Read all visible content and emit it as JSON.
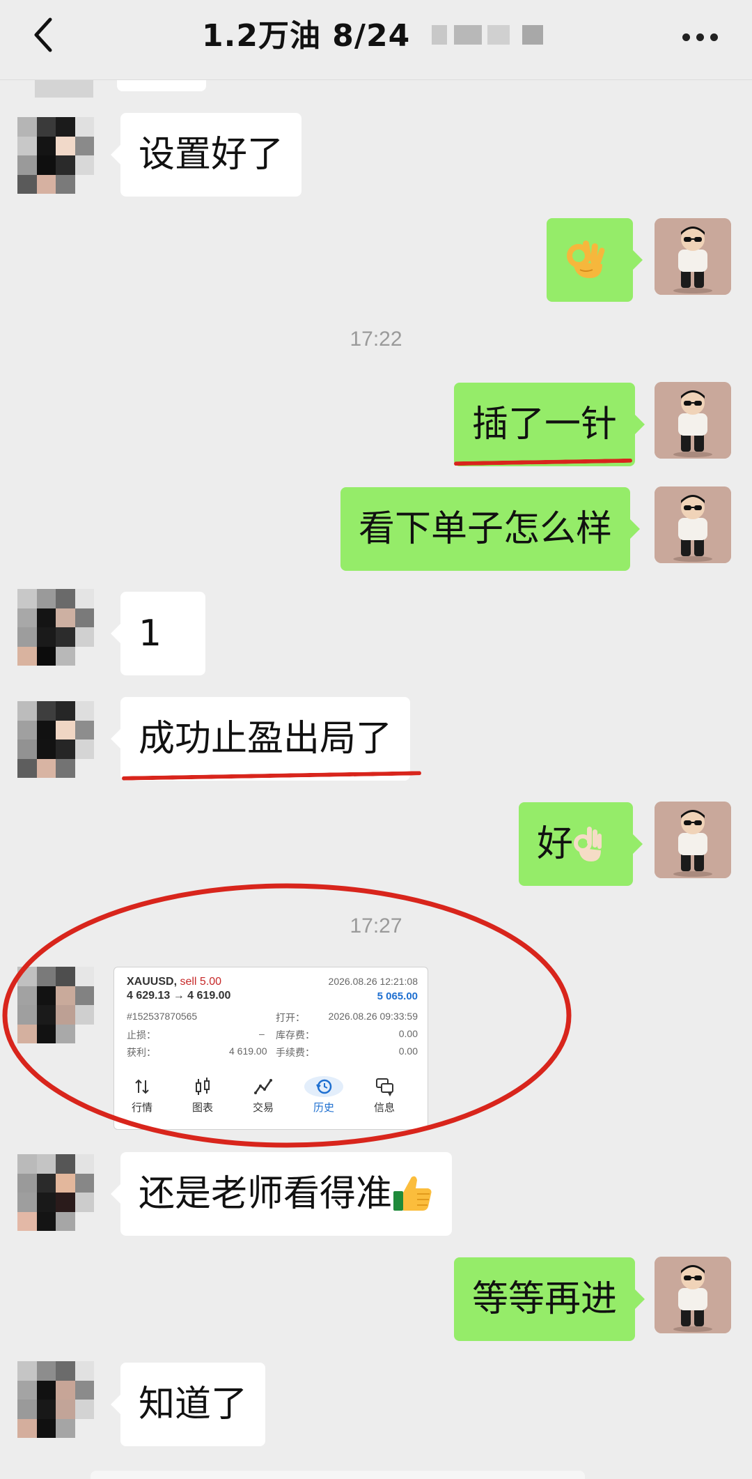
{
  "header": {
    "title": "1.2万油  8/24",
    "back_icon": "chevron-left-icon",
    "more_icon": "more-dots-icon"
  },
  "messages": {
    "m1": "设置好了",
    "m2_emoji": "ok-hand-emoji",
    "time1": "17:22",
    "m3": "插了一针",
    "m4": "看下单子怎么样",
    "m5": "1",
    "m6": "成功止盈出局了",
    "m7": "好",
    "time2": "17:27",
    "m9": "还是老师看得准",
    "m10": "等等再进",
    "m11": "知道了"
  },
  "trade_screenshot": {
    "symbol": "XAUUSD,",
    "side": "sell 5.00",
    "datetime_close": "2026.08.26 12:21:08",
    "price_change": "4 629.13 → 4 619.00",
    "profit": "5 065.00",
    "order_id": "#152537870565",
    "open_label": "打开：",
    "open_time": "2026.08.26 09:33:59",
    "sl_label": "止损：",
    "sl_value": "–",
    "swap_label": "库存费：",
    "swap_value": "0.00",
    "tp_label": "获利：",
    "tp_value": "4 619.00",
    "fee_label": "手续费：",
    "fee_value": "0.00",
    "tabs": [
      "行情",
      "图表",
      "交易",
      "历史",
      "信息"
    ],
    "active_tab": "历史"
  },
  "colors": {
    "background": "#ededed",
    "incoming_bubble": "#ffffff",
    "outgoing_bubble": "#95ec69",
    "annotation_red": "#d8251c"
  }
}
